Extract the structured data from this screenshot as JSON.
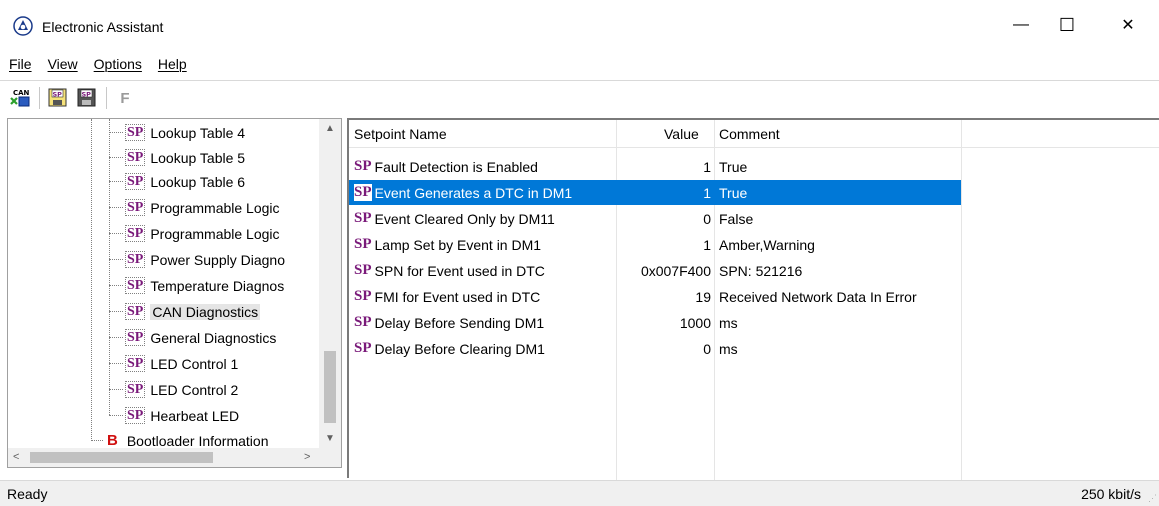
{
  "window": {
    "title": "Electronic Assistant",
    "minimize_glyph": "—",
    "maximize_glyph": "☐",
    "close_glyph": "✕"
  },
  "menu": [
    "File",
    "View",
    "Options",
    "Help"
  ],
  "toolbar": {
    "buttons": [
      {
        "icon": "can-connect-icon",
        "text": "CAN"
      },
      {
        "icon": "sp-read-icon",
        "text": "SP"
      },
      {
        "icon": "sp-write-icon",
        "text": "SP"
      },
      {
        "icon": "flash-icon",
        "text": "F"
      }
    ]
  },
  "tree": {
    "sp_badge": "SP",
    "b_badge": "B",
    "items": [
      "Lookup Table 4",
      "Lookup Table 5",
      "Lookup Table 6",
      "Programmable Logic",
      "Programmable Logic",
      "Power Supply Diagno",
      "Temperature Diagnos",
      "CAN Diagnostics",
      "General Diagnostics",
      "LED Control 1",
      "LED Control 2",
      "Hearbeat LED"
    ],
    "selected_index": 7,
    "bootloader_label": "Bootloader Information"
  },
  "list": {
    "columns": [
      "Setpoint Name",
      "Value",
      "Comment"
    ],
    "sp_prefix": "SP",
    "rows": [
      {
        "name": "Fault Detection is Enabled",
        "value": "1",
        "comment": "True"
      },
      {
        "name": "Event Generates a DTC in DM1",
        "value": "1",
        "comment": "True"
      },
      {
        "name": "Event Cleared Only by DM11",
        "value": "0",
        "comment": "False"
      },
      {
        "name": "Lamp Set by Event in DM1",
        "value": "1",
        "comment": "Amber,Warning"
      },
      {
        "name": "SPN for Event used in DTC",
        "value": "0x007F400",
        "comment": "SPN: 521216"
      },
      {
        "name": "FMI for Event used in DTC",
        "value": "19",
        "comment": "Received Network Data In Error"
      },
      {
        "name": "Delay Before Sending DM1",
        "value": "1000",
        "comment": "ms"
      },
      {
        "name": "Delay Before Clearing DM1",
        "value": "0",
        "comment": "ms"
      }
    ],
    "selected_row": 1
  },
  "status": {
    "left": "Ready",
    "right": "250 kbit/s"
  },
  "colors": {
    "selection": "#0078d7",
    "sp_badge": "#7a1a7a",
    "b_badge": "#d01010"
  }
}
